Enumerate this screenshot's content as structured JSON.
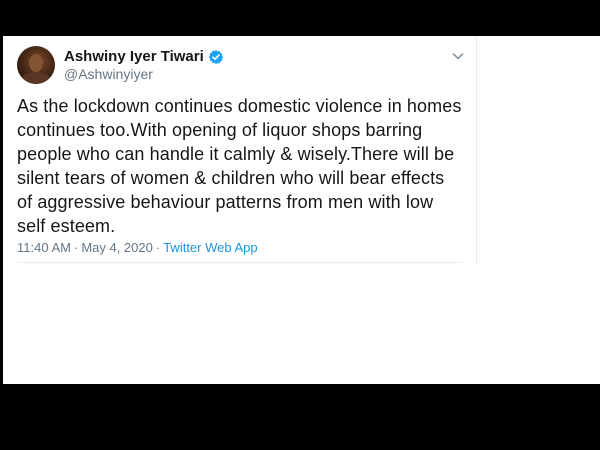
{
  "tweet": {
    "display_name": "Ashwiny Iyer Tiwari",
    "handle": "@Ashwinyiyer",
    "verified": true,
    "text": "As the lockdown continues domestic violence in homes\ncontinues too.With opening of liquor shops barring\npeople who can handle it calmly & wisely.There will be\nsilent tears of women & children who will bear effects\nof aggressive behaviour patterns from men with low\nself esteem.",
    "time": "11:40 AM",
    "separator": "·",
    "date": "May 4, 2020",
    "source": "Twitter Web App"
  },
  "icons": {
    "avatar": "profile-photo",
    "verified": "verified-badge-icon",
    "menu": "chevron-down-icon"
  },
  "colors": {
    "verified_blue": "#1da1f2",
    "link_blue": "#1b95e0",
    "text": "#14171a",
    "muted": "#657786",
    "frame": "#000000"
  }
}
